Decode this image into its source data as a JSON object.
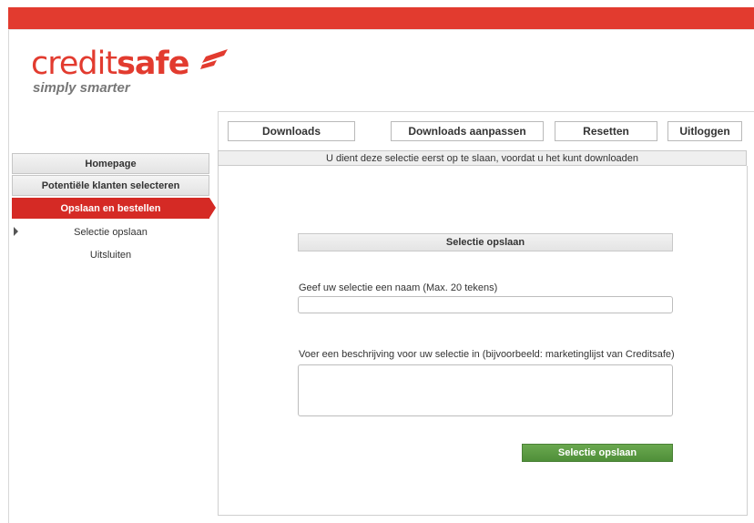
{
  "brand": {
    "name_light": "credit",
    "name_bold": "safe",
    "tagline": "simply smarter",
    "accent_color": "#e23b2f"
  },
  "toolbar": {
    "buttons": [
      {
        "label": "Downloads"
      },
      {
        "label": "Downloads aanpassen"
      },
      {
        "label": "Resetten"
      },
      {
        "label": "Uitloggen"
      }
    ]
  },
  "notice": "U dient deze selectie eerst op te slaan, voordat u het kunt downloaden",
  "sidebar": {
    "items": [
      {
        "label": "Homepage"
      },
      {
        "label": "Potentiële klanten selecteren"
      },
      {
        "label": "Opslaan en bestellen"
      }
    ],
    "subitems": [
      {
        "label": "Selectie opslaan"
      },
      {
        "label": "Uitsluiten"
      }
    ]
  },
  "form": {
    "title": "Selectie opslaan",
    "name_label": "Geef uw selectie een naam (Max. 20 tekens)",
    "name_value": "",
    "description_label": "Voer een beschrijving voor uw selectie in (bijvoorbeeld: marketinglijst van Creditsafe)",
    "description_value": "",
    "submit_label": "Selectie opslaan",
    "submit_color": "#5a9a44"
  }
}
